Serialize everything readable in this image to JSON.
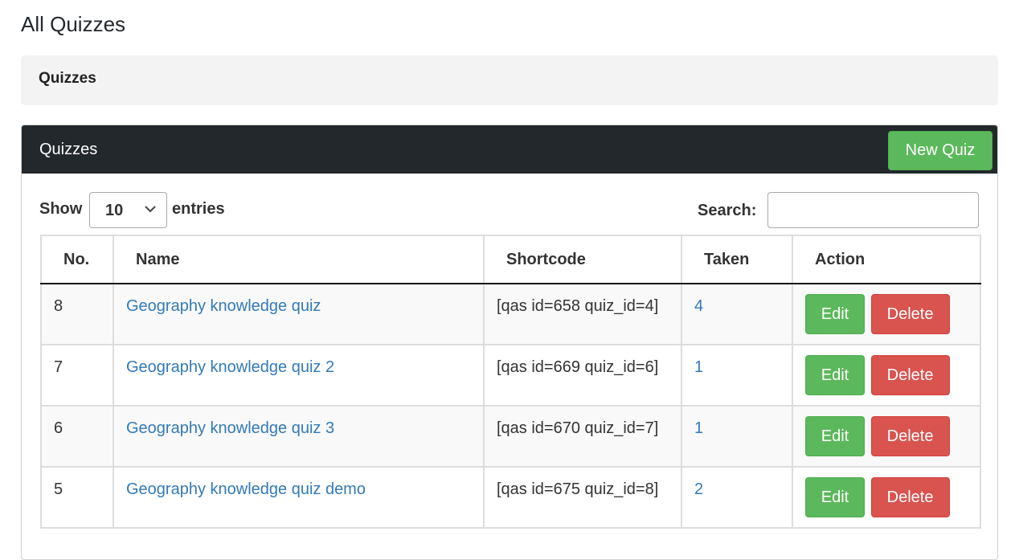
{
  "page": {
    "title": "All Quizzes",
    "sub_header": "Quizzes"
  },
  "panel": {
    "title": "Quizzes",
    "new_button": "New Quiz"
  },
  "controls": {
    "show_label": "Show",
    "entries_value": "10",
    "entries_label": "entries",
    "search_label": "Search:",
    "search_value": ""
  },
  "table": {
    "columns": [
      "No.",
      "Name",
      "Shortcode",
      "Taken",
      "Action"
    ],
    "rows": [
      {
        "no": "8",
        "name": "Geography knowledge quiz",
        "shortcode": "[qas id=658 quiz_id=4]",
        "taken": "4",
        "edit": "Edit",
        "delete": "Delete"
      },
      {
        "no": "7",
        "name": "Geography knowledge quiz 2",
        "shortcode": "[qas id=669 quiz_id=6]",
        "taken": "1",
        "edit": "Edit",
        "delete": "Delete"
      },
      {
        "no": "6",
        "name": "Geography knowledge quiz 3",
        "shortcode": "[qas id=670 quiz_id=7]",
        "taken": "1",
        "edit": "Edit",
        "delete": "Delete"
      },
      {
        "no": "5",
        "name": "Geography knowledge quiz demo",
        "shortcode": "[qas id=675 quiz_id=8]",
        "taken": "2",
        "edit": "Edit",
        "delete": "Delete"
      }
    ]
  },
  "colors": {
    "header_dark": "#23282d",
    "success": "#5cb85c",
    "danger": "#d9534f",
    "link": "#337ab7"
  },
  "icons": {
    "entries_dropdown": "chevron-down-icon"
  }
}
